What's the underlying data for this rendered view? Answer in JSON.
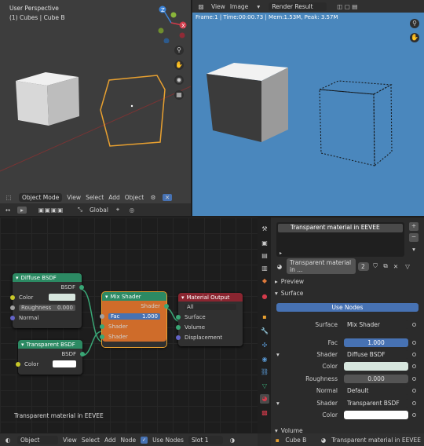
{
  "viewport_left": {
    "perspective": "User Perspective",
    "collection": "(1) Cubes | Cube B",
    "mode": "Object Mode",
    "menus": [
      "View",
      "Select",
      "Add",
      "Object"
    ],
    "orientation": "Global"
  },
  "viewport_right": {
    "menus": [
      "View",
      "Image"
    ],
    "image_name": "Render Result",
    "frame_info": "Frame:1 | Time:00:00.73 | Mem:1.53M, Peak: 3.57M"
  },
  "node_editor": {
    "footer": "Transparent material in EEVEE",
    "nodes": {
      "diffuse": {
        "title": "Diffuse BSDF",
        "out": "BSDF",
        "color_label": "Color",
        "roughness_label": "Roughness",
        "roughness": "0.000",
        "normal_label": "Normal"
      },
      "transparent": {
        "title": "Transparent BSDF",
        "out": "BSDF",
        "color_label": "Color"
      },
      "mix": {
        "title": "Mix Shader",
        "out": "Shader",
        "fac_label": "Fac",
        "fac": "1.000",
        "in1": "Shader",
        "in2": "Shader"
      },
      "output": {
        "title": "Material Output",
        "target": "All",
        "surface": "Surface",
        "volume": "Volume",
        "displacement": "Displacement"
      }
    }
  },
  "bottom_header": {
    "mode": "Object",
    "menus": [
      "View",
      "Select",
      "Add",
      "Node"
    ],
    "use_nodes": "Use Nodes",
    "slot": "Slot 1"
  },
  "properties": {
    "material_slot": "Transparent material in EEVEE",
    "material_name": "Transparent material in ...",
    "users": "2",
    "preview": "Preview",
    "surface_section": "Surface",
    "use_nodes_btn": "Use Nodes",
    "rows": {
      "surface_label": "Surface",
      "surface_val": "Mix Shader",
      "fac_label": "Fac",
      "fac_val": "1.000",
      "shader1_label": "Shader",
      "shader1_val": "Diffuse BSDF",
      "color_label": "Color",
      "roughness_label": "Roughness",
      "roughness_val": "0.000",
      "normal_label": "Normal",
      "normal_val": "Default",
      "shader2_label": "Shader",
      "shader2_val": "Transparent BSDF",
      "color2_label": "Color"
    },
    "volume_section": "Volume",
    "footer_object": "Cube B",
    "footer_material": "Transparent material in EEVEE"
  },
  "colors": {
    "viewport_bg": "#3d3d3d",
    "render_bg": "#4a87bd",
    "selection": "#e8a030",
    "node_shader": "#2c8a63",
    "node_output": "#8a2530",
    "fac_blue": "#4772b3"
  }
}
